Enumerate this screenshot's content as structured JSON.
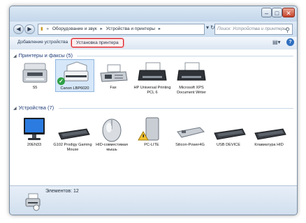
{
  "breadcrumb": [
    "Оборудование и звук",
    "Устройства и принтеры"
  ],
  "search": {
    "placeholder": "Поиск: Устройства и принтеры"
  },
  "toolbar": {
    "add_device": "Добавление устройства",
    "install_printer": "Установка принтера"
  },
  "groups": {
    "printers": {
      "label": "Принтеры и факсы (5)"
    },
    "devices": {
      "label": "Устройства (7)"
    }
  },
  "printers": [
    {
      "label": "S5",
      "icon": "multifunction-printer-icon"
    },
    {
      "label": "Canon LBP6020",
      "icon": "laser-printer-icon",
      "default": true
    },
    {
      "label": "Fax",
      "icon": "fax-icon"
    },
    {
      "label": "HP Universal Printing PCL 6",
      "icon": "printer-icon"
    },
    {
      "label": "Microsoft XPS Document Writer",
      "icon": "printer-icon"
    }
  ],
  "devices": [
    {
      "label": "20EN33",
      "icon": "monitor-icon"
    },
    {
      "label": "G102 Prodigy Gaming Mouse",
      "icon": "keyboard-icon"
    },
    {
      "label": "HID-совместимая мышь",
      "icon": "mouse-icon"
    },
    {
      "label": "PC-LITE",
      "icon": "computer-warning-icon"
    },
    {
      "label": "Silicon-Power4G",
      "icon": "usb-drive-icon"
    },
    {
      "label": "USB DEVICE",
      "icon": "keyboard-icon"
    },
    {
      "label": "Клавиатура HID",
      "icon": "keyboard-icon"
    }
  ],
  "status": {
    "text": "Элементов: 12"
  },
  "colors": {
    "selection_highlight": "#d8202a",
    "group_header": "#1e3a78",
    "default_check": "#2ea043"
  }
}
